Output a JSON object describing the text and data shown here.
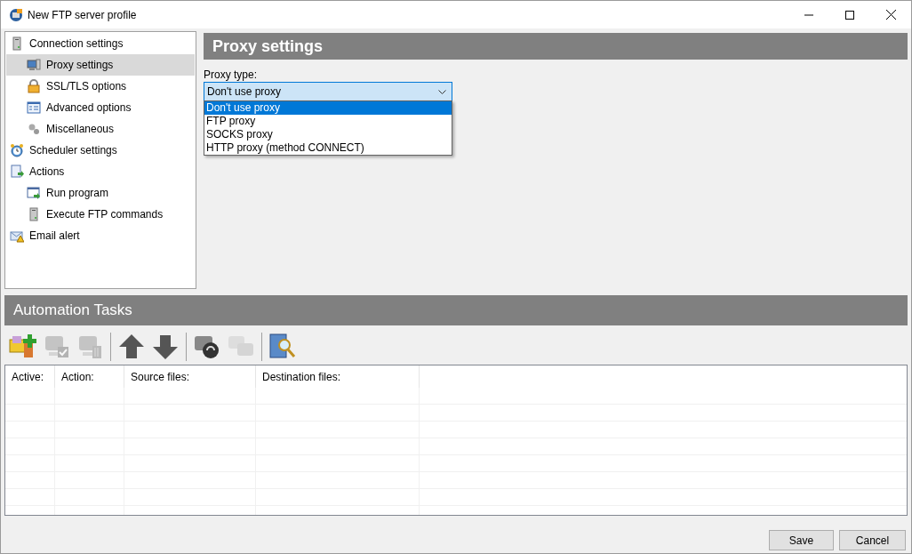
{
  "window": {
    "title": "New FTP server profile"
  },
  "tree": [
    {
      "label": "Connection settings",
      "kind": "server",
      "selected": false,
      "children": [
        {
          "label": "Proxy settings",
          "kind": "monitor",
          "selected": true
        },
        {
          "label": "SSL/TLS options",
          "kind": "lock",
          "selected": false
        },
        {
          "label": "Advanced options",
          "kind": "form",
          "selected": false
        },
        {
          "label": "Miscellaneous",
          "kind": "gears",
          "selected": false
        }
      ]
    },
    {
      "label": "Scheduler settings",
      "kind": "clock",
      "selected": false
    },
    {
      "label": "Actions",
      "kind": "scroll",
      "selected": false,
      "children": [
        {
          "label": "Run program",
          "kind": "window",
          "selected": false
        },
        {
          "label": "Execute FTP commands",
          "kind": "server",
          "selected": false
        }
      ]
    },
    {
      "label": "Email alert",
      "kind": "mail",
      "selected": false
    }
  ],
  "panel": {
    "title": "Proxy settings",
    "proxy_label": "Proxy type:",
    "proxy_value": "Don't use proxy",
    "options": [
      {
        "label": "Don't use proxy",
        "selected": true
      },
      {
        "label": "FTP proxy",
        "selected": false
      },
      {
        "label": "SOCKS proxy",
        "selected": false
      },
      {
        "label": "HTTP proxy (method CONNECT)",
        "selected": false
      }
    ]
  },
  "automation": {
    "title": "Automation Tasks",
    "toolbar": [
      {
        "kind": "add",
        "disabled": false
      },
      {
        "kind": "edit",
        "disabled": true
      },
      {
        "kind": "delete",
        "disabled": true
      },
      {
        "kind": "separator"
      },
      {
        "kind": "up",
        "disabled": false
      },
      {
        "kind": "down",
        "disabled": false
      },
      {
        "kind": "separator"
      },
      {
        "kind": "run",
        "disabled": false
      },
      {
        "kind": "sync",
        "disabled": true
      },
      {
        "kind": "separator"
      },
      {
        "kind": "find",
        "disabled": false
      }
    ],
    "columns": [
      "Active:",
      "Action:",
      "Source files:",
      "Destination files:"
    ]
  },
  "buttons": [
    "Save",
    "Cancel"
  ]
}
